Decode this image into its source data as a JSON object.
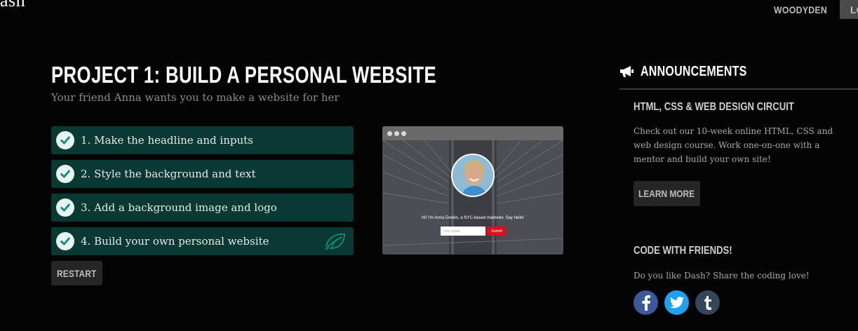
{
  "app": {
    "logo_text": "ash",
    "user_label": "WOODYDEN",
    "logout_label": "LO"
  },
  "project": {
    "title": "PROJECT 1: BUILD A PERSONAL WEBSITE",
    "subtitle": "Your friend Anna wants you to make a website for her",
    "steps": [
      {
        "label": "1. Make the headline and inputs",
        "completed": true
      },
      {
        "label": "2. Style the background and text",
        "completed": true
      },
      {
        "label": "3. Add a background image and logo",
        "completed": true
      },
      {
        "label": "4. Build your own personal website",
        "completed": true
      }
    ],
    "restart_label": "RESTART",
    "check_icon": "check-circle-icon",
    "badge_icon": "leaf-badge-icon"
  },
  "preview": {
    "headline": "Hi! I'm Anna Dowlin, a NYC-based marketer. Say hello!",
    "input_placeholder": "Your email",
    "submit_label": "Submit"
  },
  "sidebar": {
    "announcements_title": "ANNOUNCEMENTS",
    "announcements_icon": "megaphone-icon",
    "circuit_heading": "HTML, CSS & WEB DESIGN CIRCUIT",
    "circuit_text": "Check out our 10-week online HTML, CSS and web design course. Work one-on-one with a mentor and build your own site!",
    "learn_more_label": "LEARN MORE",
    "friends_heading": "CODE WITH FRIENDS!",
    "friends_text": "Do you like Dash? Share the coding love!",
    "social": [
      {
        "name": "facebook-icon",
        "glyph": "f",
        "color": "#3b5998"
      },
      {
        "name": "twitter-icon",
        "glyph": "t",
        "color": "#1da1f2"
      },
      {
        "name": "tumblr-icon",
        "glyph": "t",
        "color": "#35465c"
      }
    ]
  },
  "colors": {
    "background": "#040404",
    "step_bg": "#083a33",
    "accent_teal": "#0f8f7a",
    "button_bg": "#262626"
  }
}
